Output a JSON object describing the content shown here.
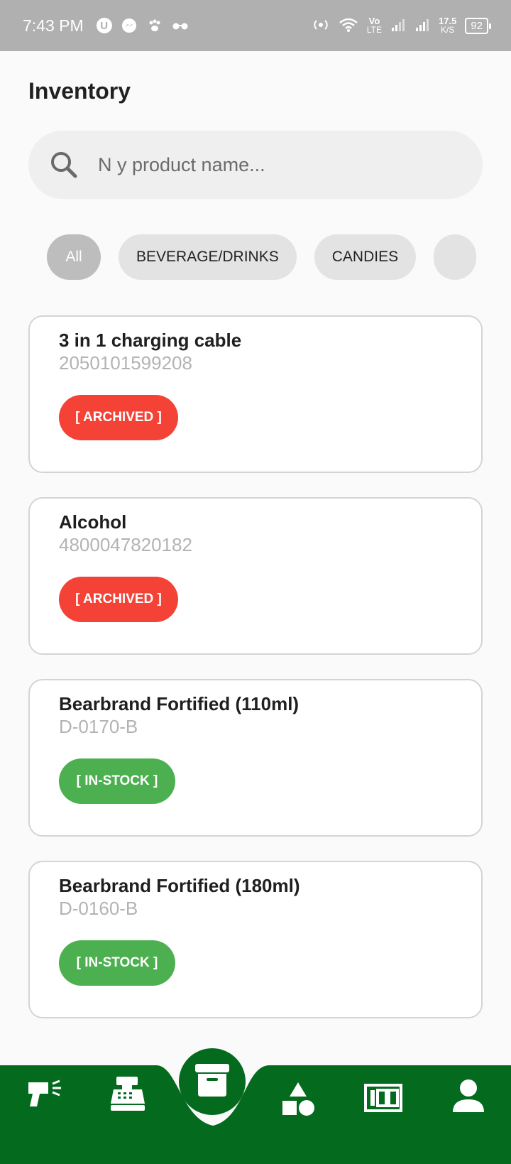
{
  "status_bar": {
    "time": "7:43 PM",
    "network_speed_value": "17.5",
    "network_speed_unit": "K/S",
    "lte_label_top": "Vo",
    "lte_label_bottom": "LTE",
    "battery": "92",
    "u_icon_label": "U"
  },
  "page": {
    "title": "Inventory"
  },
  "search": {
    "placeholder": "N y product name..."
  },
  "categories": [
    {
      "label": "All",
      "active": true
    },
    {
      "label": "BEVERAGE/DRINKS",
      "active": false
    },
    {
      "label": "CANDIES",
      "active": false
    }
  ],
  "products": [
    {
      "name": "3 in 1 charging cable",
      "code": "2050101599208",
      "status": "[ ARCHIVED ]",
      "status_type": "archived"
    },
    {
      "name": "Alcohol",
      "code": "4800047820182",
      "status": "[ ARCHIVED ]",
      "status_type": "archived"
    },
    {
      "name": "Bearbrand Fortified (110ml)",
      "code": "D-0170-B",
      "status": "[ IN-STOCK ]",
      "status_type": "instock"
    },
    {
      "name": "Bearbrand Fortified (180ml)",
      "code": "D-0160-B",
      "status": "[ IN-STOCK ]",
      "status_type": "instock"
    }
  ],
  "bottom_nav": {
    "items": [
      {
        "icon": "barcode-scanner-icon"
      },
      {
        "icon": "cash-register-icon"
      },
      {
        "icon": "inventory-box-icon",
        "active": true
      },
      {
        "icon": "categories-shapes-icon"
      },
      {
        "icon": "stock-counter-icon"
      },
      {
        "icon": "account-icon"
      }
    ]
  },
  "colors": {
    "nav_background": "#046b1e",
    "archived": "#f44336",
    "instock": "#4caf50",
    "chip_active": "#bdbdbd",
    "chip": "#e3e3e3"
  }
}
